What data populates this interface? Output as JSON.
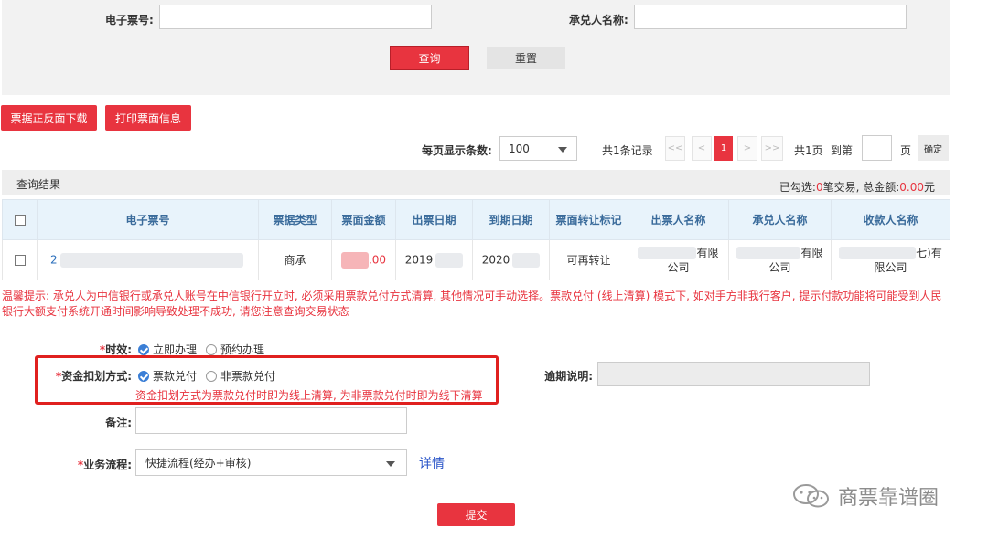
{
  "search": {
    "bill_no_label": "电子票号:",
    "acceptor_label": "承兑人名称:",
    "query_label": "查询",
    "reset_label": "重置"
  },
  "toolbar": {
    "download_label": "票据正反面下载",
    "print_label": "打印票面信息"
  },
  "pager": {
    "page_size_label": "每页显示条数:",
    "page_size": "100",
    "total_records": "共1条记录",
    "first": "<<",
    "prev": "<",
    "current_page": "1",
    "next": ">",
    "last": ">>",
    "total_pages": "共1页",
    "goto_label": "到第",
    "page_unit": "页",
    "confirm_label": "确定"
  },
  "results": {
    "title": "查询结果",
    "summary_prefix": "已勾选:",
    "selected_count": "0",
    "summary_mid": "笔交易, 总金额:",
    "total_amount": "0.00",
    "summary_suffix": "元",
    "columns": [
      "电子票号",
      "票据类型",
      "票面金额",
      "出票日期",
      "到期日期",
      "票面转让标记",
      "出票人名称",
      "承兑人名称",
      "收款人名称"
    ],
    "row": {
      "bill_no": "2",
      "bill_type": "商承",
      "amount": ".00",
      "issue_date": "2019",
      "due_date": "2020",
      "transfer_flag": "可再转让",
      "drawer_tail": "有限",
      "drawer_line2": "公司",
      "acceptor_tail": "有限",
      "acceptor_line2": "公司",
      "payee_tail": "七)有",
      "payee_line2": "限公司"
    }
  },
  "tip": "温馨提示: 承兑人为中信银行或承兑人账号在中信银行开立时, 必须采用票款兑付方式清算, 其他情况可手动选择。票款兑付 (线上清算) 模式下, 如对手方非我行客户, 提示付款功能将可能受到人民银行大额支付系统开通时间影响导致处理不成功, 请您注意查询交易状态",
  "form": {
    "timing_label": "时效:",
    "timing_options": [
      "立即办理",
      "预约办理"
    ],
    "settlement_label": "资金扣划方式:",
    "settlement_options": [
      "票款兑付",
      "非票款兑付"
    ],
    "settlement_hint": "资金扣划方式为票款兑付时即为线上清算, 为非票款兑付时即为线下清算",
    "overdue_label": "逾期说明:",
    "remark_label": "备注:",
    "flow_label": "业务流程:",
    "flow_value": "快捷流程(经办+审核)",
    "details_label": "详情",
    "submit_label": "提交"
  },
  "watermark": "商票靠谱圈",
  "colors": {
    "accent": "#e8343f",
    "header_bg": "#e8f3fb",
    "highlight": "#e0201f"
  }
}
